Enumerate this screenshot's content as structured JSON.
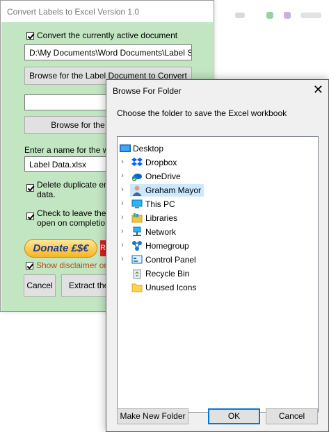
{
  "convert_window": {
    "title": "Convert Labels to Excel Version 1.0",
    "active_doc_label": "Convert the currently active document",
    "doc_path": "D:\\My Documents\\Word Documents\\Label Samp",
    "browse_label_doc": "Browse for the Label Document to Convert",
    "second_field": "",
    "browse_second": "Browse for the E",
    "name_prompt": "Enter a name for the wo",
    "workbook_name": "Label Data.xlsx",
    "dup_line1": "Delete duplicate entri",
    "dup_line2": "data.",
    "leave_line1": "Check to leave the o",
    "leave_line2": "open on completion",
    "donate": "Donate £$€",
    "red_button": "R",
    "disclaimer": "Show disclaimer on st",
    "cancel": "Cancel",
    "extract": "Extract the"
  },
  "browse_dialog": {
    "title": "Browse For Folder",
    "close": "✕",
    "prompt": "Choose the folder to save the Excel workbook",
    "root": "Desktop",
    "items": [
      {
        "label": "Dropbox",
        "icon": "dropbox-icon",
        "expandable": true
      },
      {
        "label": "OneDrive",
        "icon": "onedrive-icon",
        "expandable": true
      },
      {
        "label": "Graham Mayor",
        "icon": "user-folder-icon",
        "expandable": true,
        "selected": true
      },
      {
        "label": "This PC",
        "icon": "computer-icon",
        "expandable": true
      },
      {
        "label": "Libraries",
        "icon": "libraries-icon",
        "expandable": true
      },
      {
        "label": "Network",
        "icon": "network-icon",
        "expandable": true
      },
      {
        "label": "Homegroup",
        "icon": "homegroup-icon",
        "expandable": true
      },
      {
        "label": "Control Panel",
        "icon": "control-panel-icon",
        "expandable": true
      },
      {
        "label": "Recycle Bin",
        "icon": "recycle-bin-icon",
        "expandable": false
      },
      {
        "label": "Unused Icons",
        "icon": "folder-icon",
        "expandable": false
      }
    ],
    "make_new_folder": "Make New Folder",
    "ok": "OK",
    "cancel": "Cancel"
  }
}
